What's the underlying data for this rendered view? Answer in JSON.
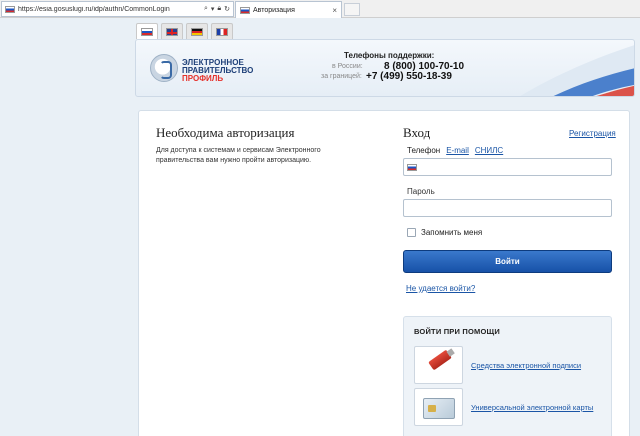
{
  "browser": {
    "url": "https://esia.gosuslugi.ru/idp/authn/CommonLogin",
    "tab_title": "Авторизация",
    "tab_close": "×"
  },
  "languages": [
    "ru",
    "en",
    "de",
    "fr"
  ],
  "header": {
    "logo_line1": "ЭЛЕКТРОННОЕ",
    "logo_line2": "ПРАВИТЕЛЬСТВО",
    "logo_line3": "ПРОФИЛЬ",
    "support_title": "Телефоны поддержки:",
    "russia_label": "в России:",
    "russia_phone": "8 (800) 100-70-10",
    "abroad_label": "за границей:",
    "abroad_phone": "+7 (499) 550-18-39"
  },
  "auth": {
    "title": "Необходима авторизация",
    "description": "Для доступа к системам и сервисам Электронного правительства вам нужно пройти авторизацию."
  },
  "login": {
    "title": "Вход",
    "register_link": "Регистрация",
    "id_tabs": [
      {
        "label": "Телефон",
        "active": true
      },
      {
        "label": "E-mail",
        "active": false
      },
      {
        "label": "СНИЛС",
        "active": false
      }
    ],
    "login_value": "",
    "password_label": "Пароль",
    "password_value": "",
    "remember_label": "Запомнить меня",
    "remember_checked": false,
    "submit_label": "Войти",
    "cant_login_link": "Не удается войти?"
  },
  "alt_login": {
    "title": "ВОЙТИ ПРИ ПОМОЩИ",
    "items": [
      {
        "label": "Средства электронной подписи",
        "icon": "usb-token-icon"
      },
      {
        "label": "Универсальной электронной карты",
        "icon": "smart-card-icon"
      }
    ]
  },
  "colors": {
    "accent": "#1a55a6",
    "button": "#1751a8",
    "brand_red": "#e5312b",
    "brand_blue": "#1d3f78"
  }
}
